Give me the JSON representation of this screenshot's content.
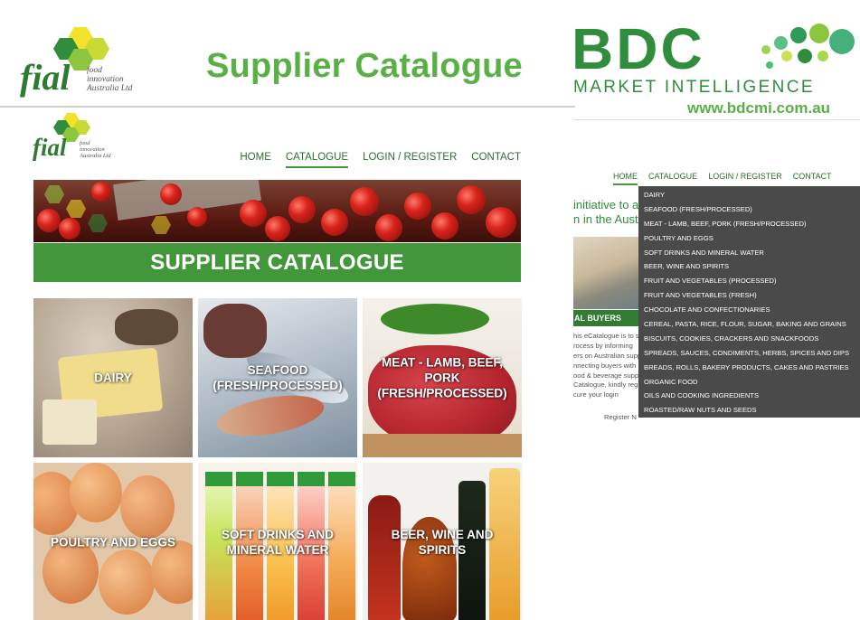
{
  "header": {
    "title": "Supplier Catalogue",
    "fial_logo": {
      "word": "fial",
      "tagline": [
        "food",
        "innovation",
        "Australia Ltd"
      ]
    },
    "bdc_logo": {
      "letters": "BDC",
      "tagline": "MARKET INTELLIGENCE",
      "url": "www.bdcmi.com.au"
    }
  },
  "left_site": {
    "logo": {
      "word": "fial",
      "tagline": [
        "food",
        "innovation",
        "Australia Ltd"
      ]
    },
    "nav": [
      {
        "label": "HOME"
      },
      {
        "label": "CATALOGUE",
        "active": true
      },
      {
        "label": "LOGIN / REGISTER"
      },
      {
        "label": "CONTACT"
      }
    ],
    "banner_title": "SUPPLIER CATALOGUE",
    "tiles": [
      {
        "label": "DAIRY"
      },
      {
        "label": "SEAFOOD (FRESH/PROCESSED)"
      },
      {
        "label": "MEAT - LAMB, BEEF, PORK (FRESH/PROCESSED)"
      },
      {
        "label": "POULTRY AND EGGS"
      },
      {
        "label": "SOFT DRINKS AND MINERAL WATER"
      },
      {
        "label": "BEER, WINE AND SPIRITS"
      }
    ]
  },
  "right_site": {
    "nav": [
      {
        "label": "HOME",
        "active": true
      },
      {
        "label": "CATALOGUE"
      },
      {
        "label": "LOGIN / REGISTER"
      },
      {
        "label": "CONTACT"
      }
    ],
    "dropdown_items": [
      "DAIRY",
      "SEAFOOD (FRESH/PROCESSED)",
      "MEAT - LAMB, BEEF, PORK (FRESH/PROCESSED)",
      "POULTRY AND EGGS",
      "SOFT DRINKS AND MINERAL WATER",
      "BEER, WINE AND SPIRITS",
      "FRUIT AND VEGETABLES (PROCESSED)",
      "FRUIT AND VEGETABLES (FRESH)",
      "CHOCOLATE AND CONFECTIONARIES",
      "CEREAL, PASTA, RICE, FLOUR, SUGAR, BAKING AND GRAINS",
      "BISCUITS, COOKIES, CRACKERS AND SNACKFOODS",
      "SPREADS, SAUCES, CONDIMENTS, HERBS, SPICES AND DIPS",
      "BREADS, ROLLS, BAKERY PRODUCTS, CAKES AND PASTRIES",
      "ORGANIC FOOD",
      "OILS AND COOKING INGREDIENTS",
      "ROASTED/RAW NUTS AND SEEDS"
    ],
    "background_text": {
      "intro_line1": "initiative to a",
      "intro_line2": "n in the Aust",
      "section_label": "AL BUYERS",
      "body_lines": [
        "his eCatalogue is to s",
        "rocess by informing",
        "ers on Australian supp",
        "nnecting buyers with",
        "ood & beverage suppli"
      ],
      "body_lines2": [
        "Catalogue, kindly regi",
        "cure your login"
      ],
      "register_fragment": "Register N"
    }
  },
  "colors": {
    "brand_green": "#43973b",
    "headline_green": "#59b146",
    "nav_green": "#2d6e2d",
    "dropdown_bg": "#4a4a4a"
  }
}
